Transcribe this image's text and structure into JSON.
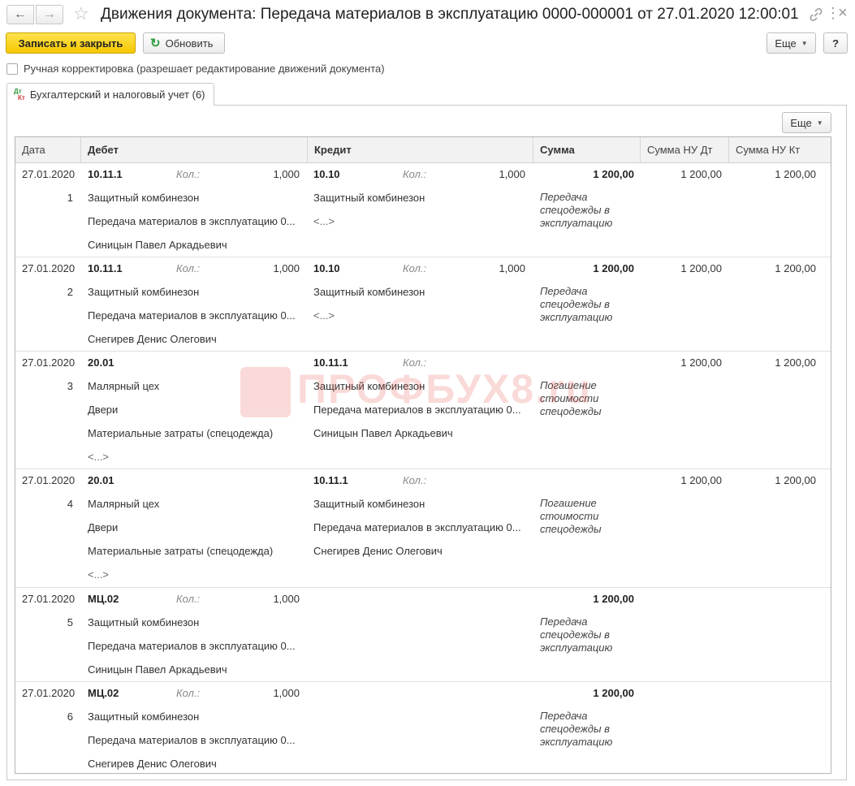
{
  "window": {
    "title": "Движения документа: Передача материалов в эксплуатацию 0000-000001 от 27.01.2020 12:00:01",
    "back_icon": "arrow-left-icon",
    "forward_icon": "arrow-right-icon",
    "favorite_icon": "star-icon",
    "more_icon": "ellipsis-icon",
    "close_icon": "close-icon"
  },
  "toolbar": {
    "save_close_label": "Записать и закрыть",
    "refresh_label": "Обновить",
    "more_label": "Еще",
    "help_label": "?"
  },
  "manual_adjustment": {
    "label": "Ручная корректировка (разрешает редактирование движений документа)",
    "checked": false
  },
  "tabs": [
    {
      "label": "Бухгалтерский и налоговый учет (6)",
      "icon": "dt-kt-icon",
      "active": true
    }
  ],
  "tab_panel": {
    "more_label": "Еще"
  },
  "watermark": {
    "text": "ПРОФБУХ8.ru"
  },
  "table": {
    "columns": [
      "Дата",
      "Дебет",
      "Кредит",
      "Сумма",
      "Сумма НУ Дт",
      "Сумма НУ Кт"
    ],
    "rows": [
      {
        "date": "27.01.2020",
        "num": "1",
        "debit_account": "10.11.1",
        "debit_qty_label": "Кол.:",
        "debit_qty": "1,000",
        "debit_sub": [
          "Защитный комбинезон",
          "Передача материалов в эксплуатацию 0...",
          "Синицын Павел Аркадьевич"
        ],
        "credit_account": "10.10",
        "credit_qty_label": "Кол.:",
        "credit_qty": "1,000",
        "credit_sub": [
          "Защитный комбинезон",
          "<...>"
        ],
        "sum": "1 200,00",
        "content": "Передача спецодежды в эксплуатацию",
        "sum_nu_dt": "1 200,00",
        "sum_nu_kt": "1 200,00"
      },
      {
        "date": "27.01.2020",
        "num": "2",
        "debit_account": "10.11.1",
        "debit_qty_label": "Кол.:",
        "debit_qty": "1,000",
        "debit_sub": [
          "Защитный комбинезон",
          "Передача материалов в эксплуатацию 0...",
          "Снегирев Денис Олегович"
        ],
        "credit_account": "10.10",
        "credit_qty_label": "Кол.:",
        "credit_qty": "1,000",
        "credit_sub": [
          "Защитный комбинезон",
          "<...>"
        ],
        "sum": "1 200,00",
        "content": "Передача спецодежды в эксплуатацию",
        "sum_nu_dt": "1 200,00",
        "sum_nu_kt": "1 200,00"
      },
      {
        "date": "27.01.2020",
        "num": "3",
        "debit_account": "20.01",
        "debit_qty_label": "",
        "debit_qty": "",
        "debit_sub": [
          "Малярный цех",
          "Двери",
          "Материальные затраты (спецодежда)",
          "<...>"
        ],
        "credit_account": "10.11.1",
        "credit_qty_label": "Кол.:",
        "credit_qty": "",
        "credit_sub": [
          "Защитный комбинезон",
          "Передача материалов в эксплуатацию 0...",
          "Синицын Павел Аркадьевич"
        ],
        "sum": "",
        "content": "Погашение стоимости спецодежды",
        "sum_nu_dt": "1 200,00",
        "sum_nu_kt": "1 200,00"
      },
      {
        "date": "27.01.2020",
        "num": "4",
        "debit_account": "20.01",
        "debit_qty_label": "",
        "debit_qty": "",
        "debit_sub": [
          "Малярный цех",
          "Двери",
          "Материальные затраты (спецодежда)",
          "<...>"
        ],
        "credit_account": "10.11.1",
        "credit_qty_label": "Кол.:",
        "credit_qty": "",
        "credit_sub": [
          "Защитный комбинезон",
          "Передача материалов в эксплуатацию 0...",
          "Снегирев Денис Олегович"
        ],
        "sum": "",
        "content": "Погашение стоимости спецодежды",
        "sum_nu_dt": "1 200,00",
        "sum_nu_kt": "1 200,00"
      },
      {
        "date": "27.01.2020",
        "num": "5",
        "debit_account": "МЦ.02",
        "debit_qty_label": "Кол.:",
        "debit_qty": "1,000",
        "debit_sub": [
          "Защитный комбинезон",
          "Передача материалов в эксплуатацию 0...",
          "Синицын Павел Аркадьевич"
        ],
        "credit_account": "",
        "credit_qty_label": "",
        "credit_qty": "",
        "credit_sub": [],
        "sum": "1 200,00",
        "content": "Передача спецодежды в эксплуатацию",
        "sum_nu_dt": "",
        "sum_nu_kt": ""
      },
      {
        "date": "27.01.2020",
        "num": "6",
        "debit_account": "МЦ.02",
        "debit_qty_label": "Кол.:",
        "debit_qty": "1,000",
        "debit_sub": [
          "Защитный комбинезон",
          "Передача материалов в эксплуатацию 0...",
          "Снегирев Денис Олегович"
        ],
        "credit_account": "",
        "credit_qty_label": "",
        "credit_qty": "",
        "credit_sub": [],
        "sum": "1 200,00",
        "content": "Передача спецодежды в эксплуатацию",
        "sum_nu_dt": "",
        "sum_nu_kt": ""
      }
    ]
  }
}
